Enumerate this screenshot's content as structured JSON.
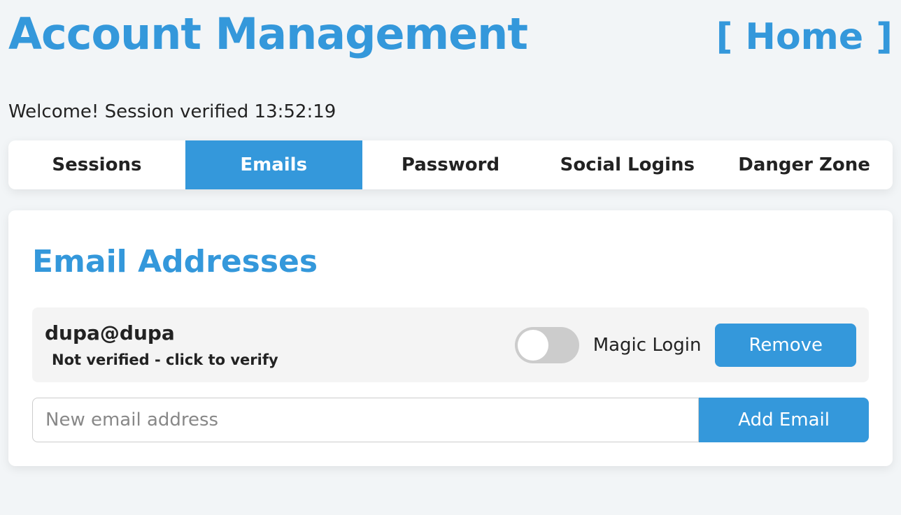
{
  "header": {
    "title": "Account Management",
    "home_link": "[ Home ]"
  },
  "welcome_text": "Welcome! Session verified 13:52:19",
  "tabs": [
    {
      "label": "Sessions",
      "active": false
    },
    {
      "label": "Emails",
      "active": true
    },
    {
      "label": "Password",
      "active": false
    },
    {
      "label": "Social Logins",
      "active": false
    },
    {
      "label": "Danger Zone",
      "active": false
    }
  ],
  "panel": {
    "heading": "Email Addresses",
    "emails": [
      {
        "address": "dupa@dupa",
        "status_text": "Not verified - click to verify",
        "magic_login_label": "Magic Login",
        "magic_login_on": false,
        "remove_label": "Remove"
      }
    ],
    "add_placeholder": "New email address",
    "add_button": "Add Email"
  }
}
